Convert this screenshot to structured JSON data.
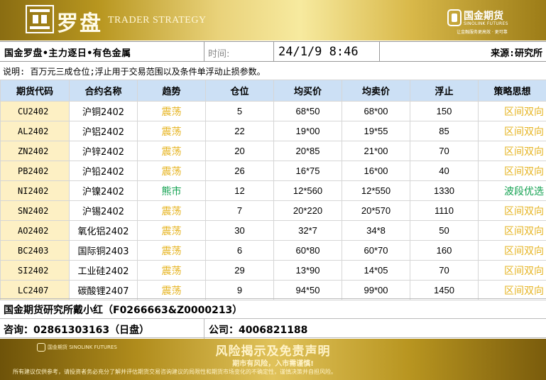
{
  "header": {
    "logo_cn": "罗盘",
    "logo_en": "TRADER STRATEGY",
    "brand_cn": "国金期货",
    "brand_en": "SINOLINK FUTURES",
    "brand_slogan": "让金融服务更高效 · 更可靠"
  },
  "info": {
    "title": "国金罗盘•主力逐日•有色金属",
    "time_label": "时间:",
    "time_value": "24/1/9 8:46",
    "source": "来源:研究所"
  },
  "note": "说明: 百万元三成仓位;浮止用于交易范围以及条件单浮动止损参数。",
  "table": {
    "headers": [
      "期货代码",
      "合约名称",
      "趋势",
      "仓位",
      "均买价",
      "均卖价",
      "浮止",
      "策略思想"
    ],
    "rows": [
      {
        "code": "CU2402",
        "name": "沪铜2402",
        "trend": "震荡",
        "position": "5",
        "buy": "68*50",
        "sell": "68*00",
        "stop": "150",
        "strategy": "区间双向"
      },
      {
        "code": "AL2402",
        "name": "沪铝2402",
        "trend": "震荡",
        "position": "22",
        "buy": "19*00",
        "sell": "19*55",
        "stop": "85",
        "strategy": "区间双向"
      },
      {
        "code": "ZN2402",
        "name": "沪锌2402",
        "trend": "震荡",
        "position": "20",
        "buy": "20*85",
        "sell": "21*00",
        "stop": "70",
        "strategy": "区间双向"
      },
      {
        "code": "PB2402",
        "name": "沪铅2402",
        "trend": "震荡",
        "position": "26",
        "buy": "16*75",
        "sell": "16*00",
        "stop": "40",
        "strategy": "区间双向"
      },
      {
        "code": "NI2402",
        "name": "沪镍2402",
        "trend": "熊市",
        "position": "12",
        "buy": "12*560",
        "sell": "12*550",
        "stop": "1330",
        "strategy": "波段优选"
      },
      {
        "code": "SN2402",
        "name": "沪锡2402",
        "trend": "震荡",
        "position": "7",
        "buy": "20*220",
        "sell": "20*570",
        "stop": "1110",
        "strategy": "区间双向"
      },
      {
        "code": "AO2402",
        "name": "氧化铝2402",
        "trend": "震荡",
        "position": "30",
        "buy": "32*7",
        "sell": "34*8",
        "stop": "50",
        "strategy": "区间双向"
      },
      {
        "code": "BC2403",
        "name": "国际铜2403",
        "trend": "震荡",
        "position": "6",
        "buy": "60*80",
        "sell": "60*70",
        "stop": "160",
        "strategy": "区间双向"
      },
      {
        "code": "SI2402",
        "name": "工业硅2402",
        "trend": "震荡",
        "position": "29",
        "buy": "13*90",
        "sell": "14*05",
        "stop": "70",
        "strategy": "区间双向"
      },
      {
        "code": "LC2407",
        "name": "碳酸锂2407",
        "trend": "震荡",
        "position": "9",
        "buy": "94*50",
        "sell": "99*00",
        "stop": "1450",
        "strategy": "区间双向"
      }
    ]
  },
  "footer": {
    "author": "国金期货研究所戴小红（F0266663&Z0000213）",
    "consult": "咨询：02861303163（日盘）",
    "company": "公司：4006821188"
  },
  "disclaimer": {
    "logo_cn": "国金期货",
    "logo_en": "SINOLINK FUTURES",
    "title": "风险揭示及免责声明",
    "subtitle": "期市有风险，入市需谨慎!",
    "text": "所有建议仅供参考，请投资者务必充分了解并评估期货交易咨询建议的局限性和期货市场变化的不确定性，谨慎决策并自担风险。"
  },
  "colors": {
    "oscillate": "#e6b422",
    "bear": "#12a150",
    "header_bg": "#cce0f5",
    "code_bg": "#fdf0c4"
  }
}
